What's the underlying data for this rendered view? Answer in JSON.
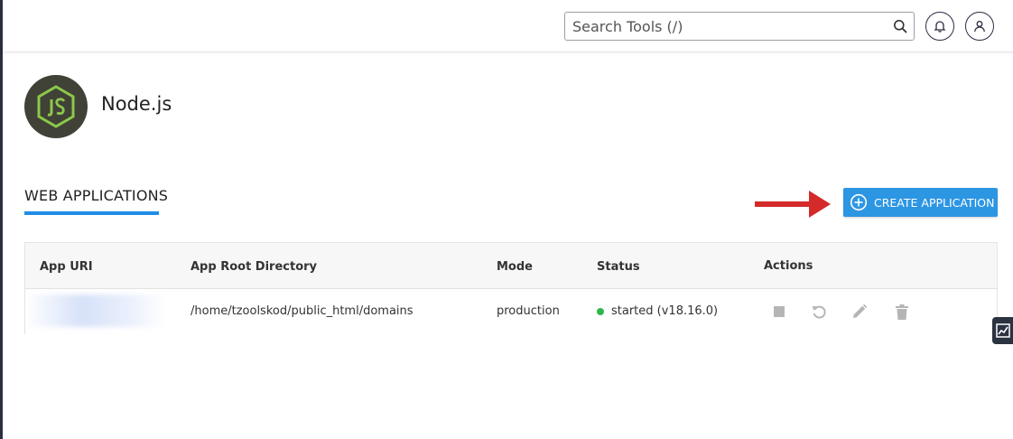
{
  "header": {
    "search": {
      "placeholder": "Search Tools (/)",
      "value": ""
    }
  },
  "app": {
    "title": "Node.js",
    "logo_text": "JS"
  },
  "section": {
    "tab_label": "WEB APPLICATIONS"
  },
  "create_button": {
    "label": "CREATE APPLICATION"
  },
  "table": {
    "columns": [
      "App URI",
      "App Root Directory",
      "Mode",
      "Status",
      "Actions"
    ],
    "rows": [
      {
        "app_uri": "",
        "app_root": "/home/tzoolskod/public_html/domains",
        "mode": "production",
        "status": "started (v18.16.0)"
      }
    ]
  },
  "colors": {
    "accent": "#2d96e3",
    "arrow": "#d42a2a",
    "status_ok": "#2db64a",
    "node_green": "#8cc84b"
  }
}
